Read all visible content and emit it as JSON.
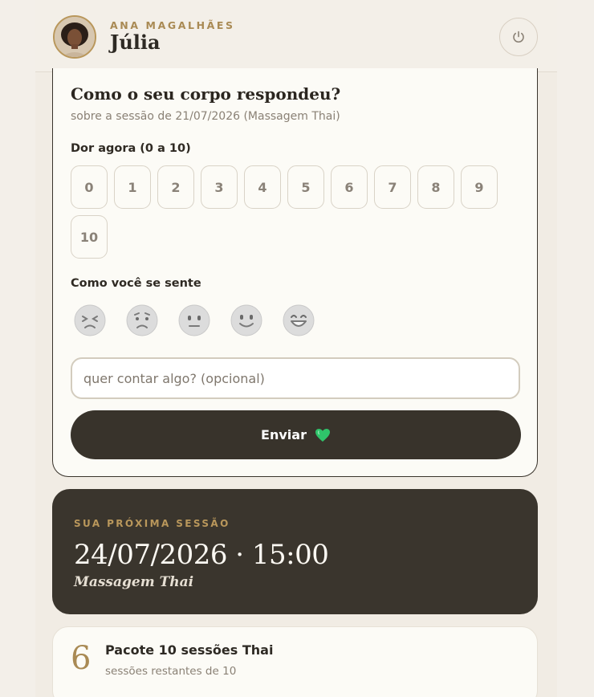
{
  "header": {
    "brand": "ANA MAGALHÃES",
    "user_name": "Júlia",
    "power_icon": "power-icon"
  },
  "feedback": {
    "title": "Como o seu corpo respondeu?",
    "subtitle": "sobre a sessão de 21/07/2026 (Massagem Thai)",
    "pain_label": "Dor agora (0 a 10)",
    "pain_scale": [
      "0",
      "1",
      "2",
      "3",
      "4",
      "5",
      "6",
      "7",
      "8",
      "9",
      "10"
    ],
    "mood_label": "Como você se sente",
    "moods": [
      "tired-face-icon",
      "worried-face-icon",
      "neutral-face-icon",
      "smiling-face-icon",
      "grinning-face-icon"
    ],
    "note_placeholder": "quer contar algo? (opcional)",
    "send_label": "Enviar",
    "send_icon": "green-heart-icon"
  },
  "next_session": {
    "label": "SUA PRÓXIMA SESSÃO",
    "datetime": "24/07/2026 · 15:00",
    "service": "Massagem Thai"
  },
  "package": {
    "remaining": "6",
    "title": "Pacote 10 sessões Thai",
    "subtitle": "sessões restantes de 10"
  },
  "colors": {
    "accent_gold": "#a98a54",
    "dark": "#38332b",
    "background": "#f1ece4",
    "heart": "#2fc46a"
  }
}
